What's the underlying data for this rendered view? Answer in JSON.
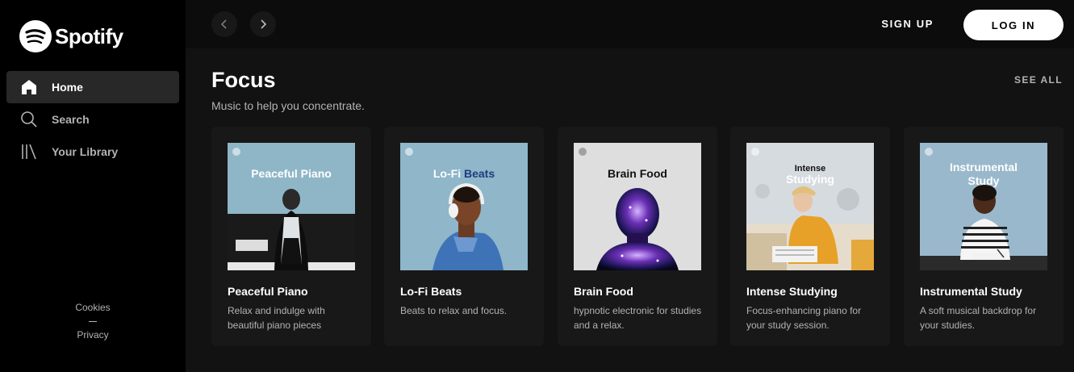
{
  "brand": {
    "name": "Spotify"
  },
  "sidebar": {
    "items": [
      {
        "label": "Home",
        "icon": "home-icon",
        "active": true
      },
      {
        "label": "Search",
        "icon": "search-icon",
        "active": false
      },
      {
        "label": "Your Library",
        "icon": "library-icon",
        "active": false
      }
    ],
    "footer": {
      "cookies": "Cookies",
      "privacy": "Privacy"
    }
  },
  "topbar": {
    "sign_up": "SIGN UP",
    "log_in": "LOG IN"
  },
  "section": {
    "title": "Focus",
    "subtitle": "Music to help you concentrate.",
    "see_all": "SEE ALL"
  },
  "cards": [
    {
      "title": "Peaceful Piano",
      "desc": "Relax and indulge with beautiful piano pieces",
      "cover_text": "Peaceful Piano"
    },
    {
      "title": "Lo-Fi Beats",
      "desc": "Beats to relax and focus.",
      "cover_text_a": "Lo-Fi ",
      "cover_text_b": "Beats"
    },
    {
      "title": "Brain Food",
      "desc": "hypnotic electronic for studies and a relax.",
      "cover_text": "Brain Food"
    },
    {
      "title": "Intense Studying",
      "desc": "Focus-enhancing piano for your study session.",
      "cover_text_a": "Intense",
      "cover_text_b": "Studying"
    },
    {
      "title": "Instrumental Study",
      "desc": "A soft musical backdrop for your studies.",
      "cover_text_a": "Instrumental",
      "cover_text_b": "Study"
    }
  ],
  "colors": {
    "background": "#121212",
    "sidebar": "#000000",
    "card": "#181818",
    "accent": "#ffffff"
  }
}
